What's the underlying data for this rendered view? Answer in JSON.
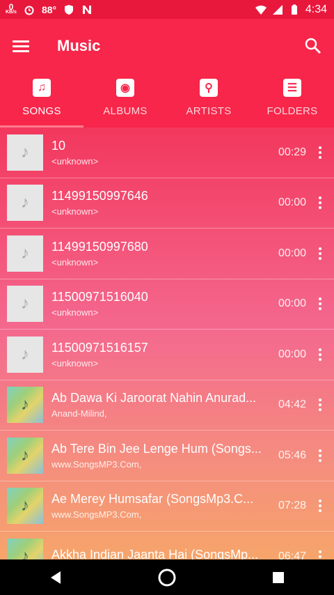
{
  "statusbar": {
    "speed_value": "0",
    "speed_unit": "KB/s",
    "temperature": "88°",
    "time": "4:34",
    "icons": [
      "alarm-icon",
      "shield-icon",
      "n-icon",
      "wifi-icon",
      "signal-icon",
      "battery-icon"
    ]
  },
  "appbar": {
    "title": "Music"
  },
  "tabs": [
    {
      "label": "SONGS",
      "icon": "music-note-icon",
      "active": true
    },
    {
      "label": "ALBUMS",
      "icon": "disc-icon",
      "active": false
    },
    {
      "label": "ARTISTS",
      "icon": "mic-icon",
      "active": false
    },
    {
      "label": "FOLDERS",
      "icon": "list-icon",
      "active": false
    }
  ],
  "songs": [
    {
      "title": "10",
      "artist": "<unknown>",
      "duration": "00:29",
      "art": false
    },
    {
      "title": "11499150997646",
      "artist": "<unknown>",
      "duration": "00:00",
      "art": false
    },
    {
      "title": "11499150997680",
      "artist": "<unknown>",
      "duration": "00:00",
      "art": false
    },
    {
      "title": "11500971516040",
      "artist": "<unknown>",
      "duration": "00:00",
      "art": false
    },
    {
      "title": "11500971516157",
      "artist": "<unknown>",
      "duration": "00:00",
      "art": false
    },
    {
      "title": "Ab Dawa Ki Jaroorat Nahin Anurad...",
      "artist": "Anand-Milind,",
      "duration": "04:42",
      "art": true
    },
    {
      "title": "Ab Tere Bin Jee Lenge Hum (Songs...",
      "artist": "www.SongsMP3.Com,",
      "duration": "05:46",
      "art": true
    },
    {
      "title": "Ae Merey Humsafar (SongsMp3.C...",
      "artist": "www.SongsMP3.Com,",
      "duration": "07:28",
      "art": true
    },
    {
      "title": "Akkha Indian Jaanta Hai (SongsMp...",
      "artist": "",
      "duration": "06:47",
      "art": true
    }
  ],
  "navbar": {
    "buttons": [
      "back-icon",
      "home-icon",
      "recents-icon"
    ]
  }
}
